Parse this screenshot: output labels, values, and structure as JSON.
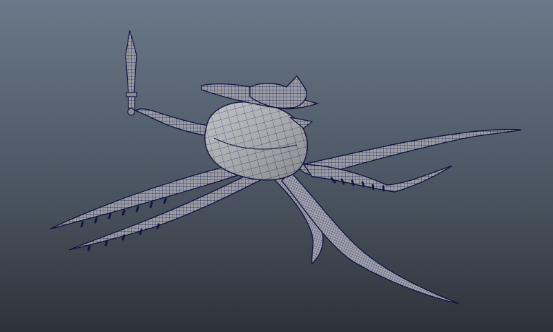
{
  "viewport": {
    "background_top": "#6a7889",
    "background_bottom": "#2e3339"
  },
  "model": {
    "name_semantic": "octopus-pirate-wireframe",
    "surface_color": "#9a9ca1",
    "wire_color": "#1c1f5c",
    "outline_color": "#12143f",
    "icon": "octopus-icon"
  }
}
